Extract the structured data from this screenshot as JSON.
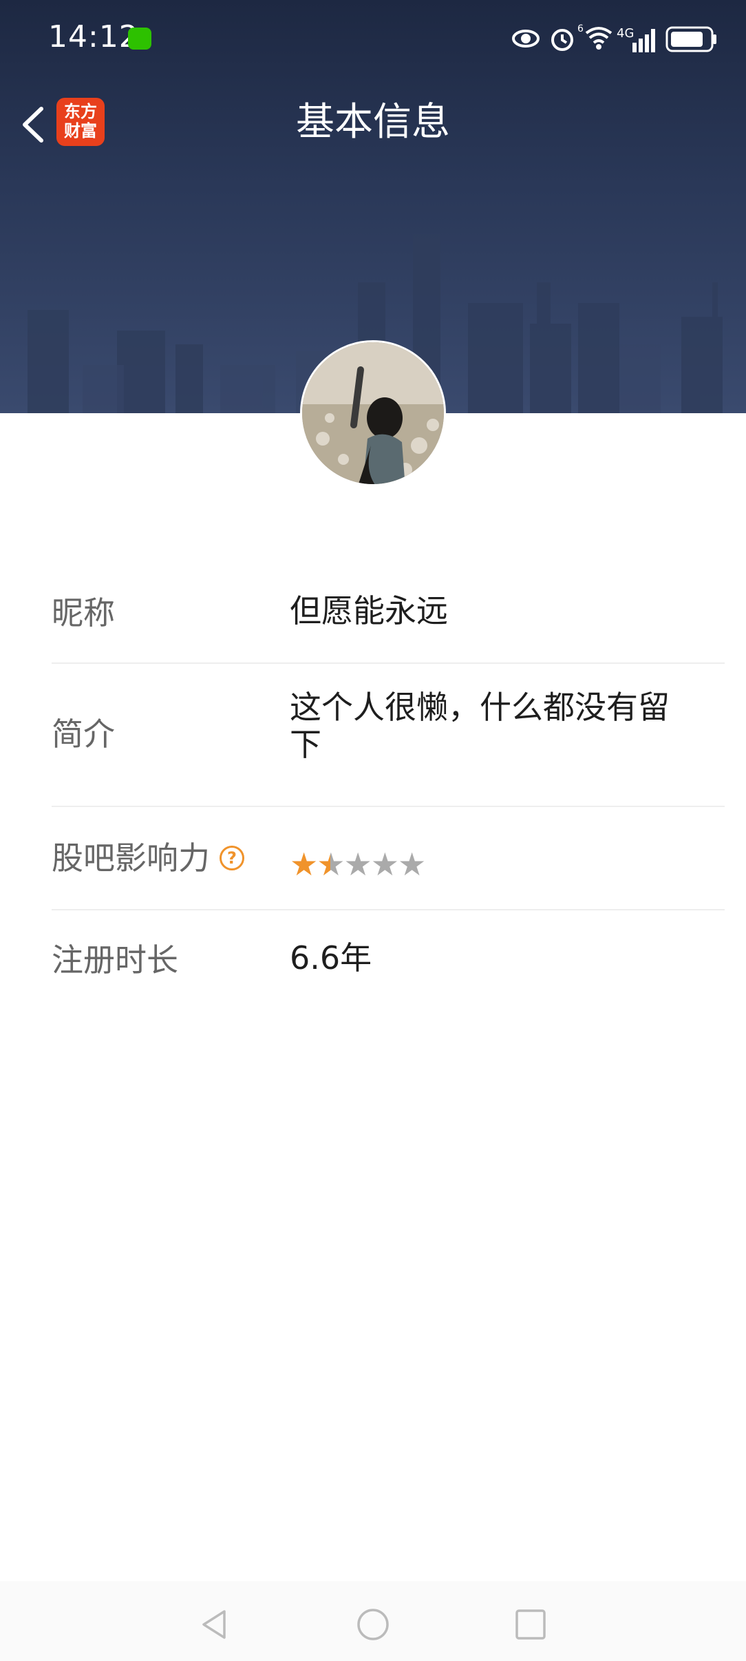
{
  "status_bar": {
    "time": "14:12",
    "network_label": "4G",
    "sim_label": "6"
  },
  "nav": {
    "title": "基本信息",
    "logo_line1": "东方",
    "logo_line2": "财富"
  },
  "profile": {
    "rows": [
      {
        "label": "昵称",
        "value": "但愿能永远"
      },
      {
        "label": "简介",
        "value": "这个人很懒，什么都没有留下"
      },
      {
        "label": "股吧影响力",
        "help": "?",
        "rating": 1.5,
        "rating_max": 5
      },
      {
        "label": "注册时长",
        "value": "6.6年"
      }
    ]
  },
  "colors": {
    "header_dark": "#1d2842",
    "accent_orange": "#f0932b",
    "logo_red": "#e8401c"
  }
}
